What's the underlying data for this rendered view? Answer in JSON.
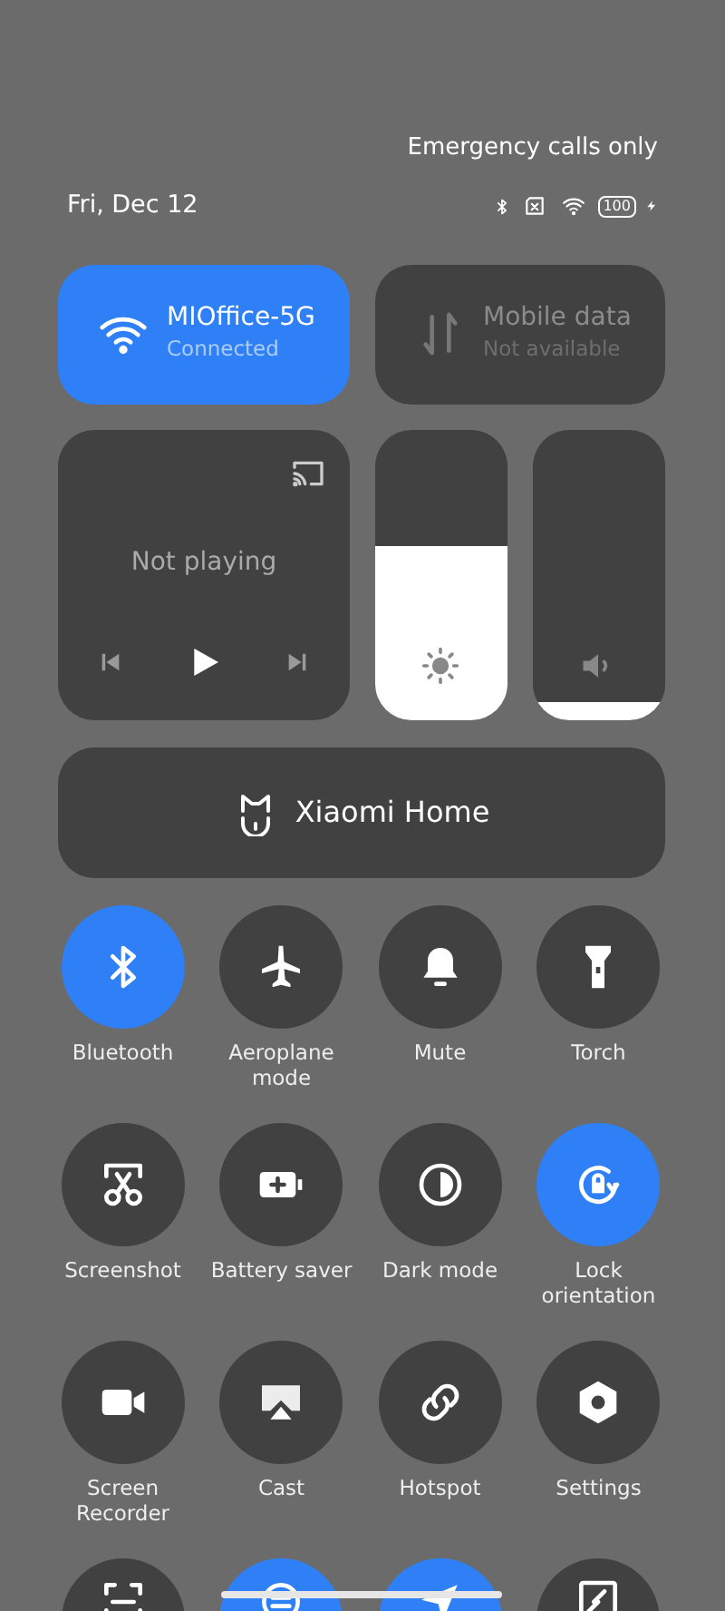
{
  "status_bar": {
    "carrier": "Emergency calls only",
    "date": "Fri, Dec 12",
    "battery": "100"
  },
  "wifi": {
    "name": "MIOffice-5G",
    "status": "Connected",
    "on": true
  },
  "mobile_data": {
    "name": "Mobile data",
    "status": "Not available",
    "on": false
  },
  "media": {
    "title": "Not playing"
  },
  "brightness": {
    "level": 0.6
  },
  "volume": {
    "level": 0.06
  },
  "smart_home": {
    "label": "Xiaomi Home"
  },
  "tiles": [
    {
      "label": "Bluetooth",
      "on": true
    },
    {
      "label": "Aeroplane mode",
      "on": false
    },
    {
      "label": "Mute",
      "on": false
    },
    {
      "label": "Torch",
      "on": false
    },
    {
      "label": "Screenshot",
      "on": false
    },
    {
      "label": "Battery saver",
      "on": false
    },
    {
      "label": "Dark mode",
      "on": false
    },
    {
      "label": "Lock orientation",
      "on": true
    },
    {
      "label": "Screen Recorder",
      "on": false
    },
    {
      "label": "Cast",
      "on": false
    },
    {
      "label": "Hotspot",
      "on": false
    },
    {
      "label": "Settings",
      "on": false
    },
    {
      "on": false
    },
    {
      "on": true
    },
    {
      "on": true
    },
    {
      "on": false
    }
  ]
}
